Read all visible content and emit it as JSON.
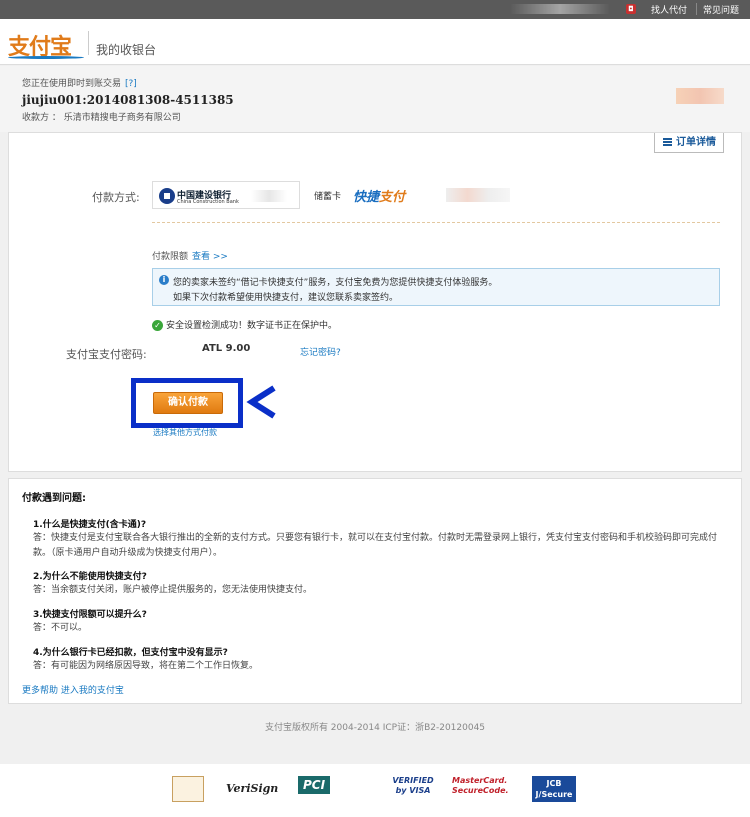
{
  "topbar": {
    "links": [
      "找人代付",
      "常见问题"
    ]
  },
  "header": {
    "logo": "支付宝",
    "subtitle": "我的收银台"
  },
  "order": {
    "using_label": "您正在使用即时到账交易",
    "help_mark": "[?]",
    "order_no": "jiujiu001:2014081308-4511385",
    "payee": "收款方 ：  乐清市精搜电子商务有限公司"
  },
  "detail_tab": "订单详情",
  "payment": {
    "method_label": "付款方式:",
    "bank_name": "中国建设银行",
    "bank_name_en": "China Construction Bank",
    "card_type": "储蓄卡",
    "express_logo_a": "快捷",
    "express_logo_b": "支付",
    "limit_label": "付款限额",
    "limit_view": "查看 >>",
    "notice_line1": "您的卖家未签约“借记卡快捷支付”服务，支付宝免费为您提供快捷支付体验服务。",
    "notice_line2": "如果下次付款希望使用快捷支付，建议您联系卖家签约。",
    "security_text": "安全设置检测成功！数字证书正在保护中。",
    "password_label": "支付宝支付密码:",
    "password_value": "ATL 9.00",
    "forgot_password": "忘记密码?",
    "confirm_button": "确认付款",
    "other_method": "选择其他方式付款"
  },
  "faq": {
    "title": "付款遇到问题:",
    "items": [
      {
        "q": "1.什么是快捷支付(含卡通)?",
        "a": "答：快捷支付是支付宝联合各大银行推出的全新的支付方式。只要您有银行卡，就可以在支付宝付款。付款时无需登录网上银行，凭支付宝支付密码和手机校验码即可完成付款。（原卡通用户自动升级成为快捷支付用户）。"
      },
      {
        "q": "2.为什么不能使用快捷支付?",
        "a": "答：当余额支付关闭，账户被停止提供服务的，您无法使用快捷支付。"
      },
      {
        "q": "3.快捷支付限额可以提升么?",
        "a": "答：不可以。"
      },
      {
        "q": "4.为什么银行卡已经扣款，但支付宝中没有显示?",
        "a": "答：有可能因为网络原因导致，将在第二个工作日恢复。"
      }
    ],
    "more_help": "更多帮助  进入我的支付宝"
  },
  "footer": "支付宝版权所有  2004-2014 ICP证：浙B2-20120045",
  "badges": [
    "VeriSign",
    "PCI",
    "VERIFIED by VISA",
    "MasterCard. SecureCode.",
    "JCB J/Secure"
  ],
  "colors": {
    "brand_orange": "#e07b1a",
    "link_blue": "#1a7ac2",
    "highlight_blue": "#0a2fc8"
  }
}
